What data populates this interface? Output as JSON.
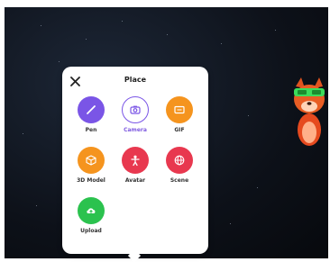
{
  "menu": {
    "title": "Place",
    "close_icon": "close-icon",
    "items": [
      {
        "label": "Pen",
        "icon": "pen-icon",
        "color": "#7a55e6"
      },
      {
        "label": "Camera",
        "icon": "camera-icon",
        "color": "#ffffff",
        "ring": "#7a55e6",
        "selected": true
      },
      {
        "label": "GIF",
        "icon": "gif-icon",
        "color": "#f5941e"
      },
      {
        "label": "3D Model",
        "icon": "cube-icon",
        "color": "#f5941e"
      },
      {
        "label": "Avatar",
        "icon": "avatar-icon",
        "color": "#e8384f"
      },
      {
        "label": "Scene",
        "icon": "globe-icon",
        "color": "#e8384f"
      },
      {
        "label": "Upload",
        "icon": "upload-icon",
        "color": "#2bc24e"
      }
    ]
  },
  "scene": {
    "background": "#0d1119",
    "avatar": "robot-avatar"
  }
}
